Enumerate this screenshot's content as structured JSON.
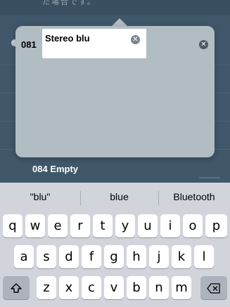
{
  "background": {
    "top_text": "た場合です。",
    "item_label": "084 Empty"
  },
  "popover": {
    "channel_number": "081",
    "edit_value": "Stereo blu"
  },
  "keyboard": {
    "suggestions": [
      "\"blu\"",
      "blue",
      "Bluetooth"
    ],
    "row1": [
      "q",
      "w",
      "e",
      "r",
      "t",
      "y",
      "u",
      "i",
      "o",
      "p"
    ],
    "row2": [
      "a",
      "s",
      "d",
      "f",
      "g",
      "h",
      "j",
      "k",
      "l"
    ],
    "row3": [
      "z",
      "x",
      "c",
      "v",
      "b",
      "n",
      "m"
    ],
    "shift_icon": "shift-icon",
    "delete_icon": "delete-icon"
  }
}
